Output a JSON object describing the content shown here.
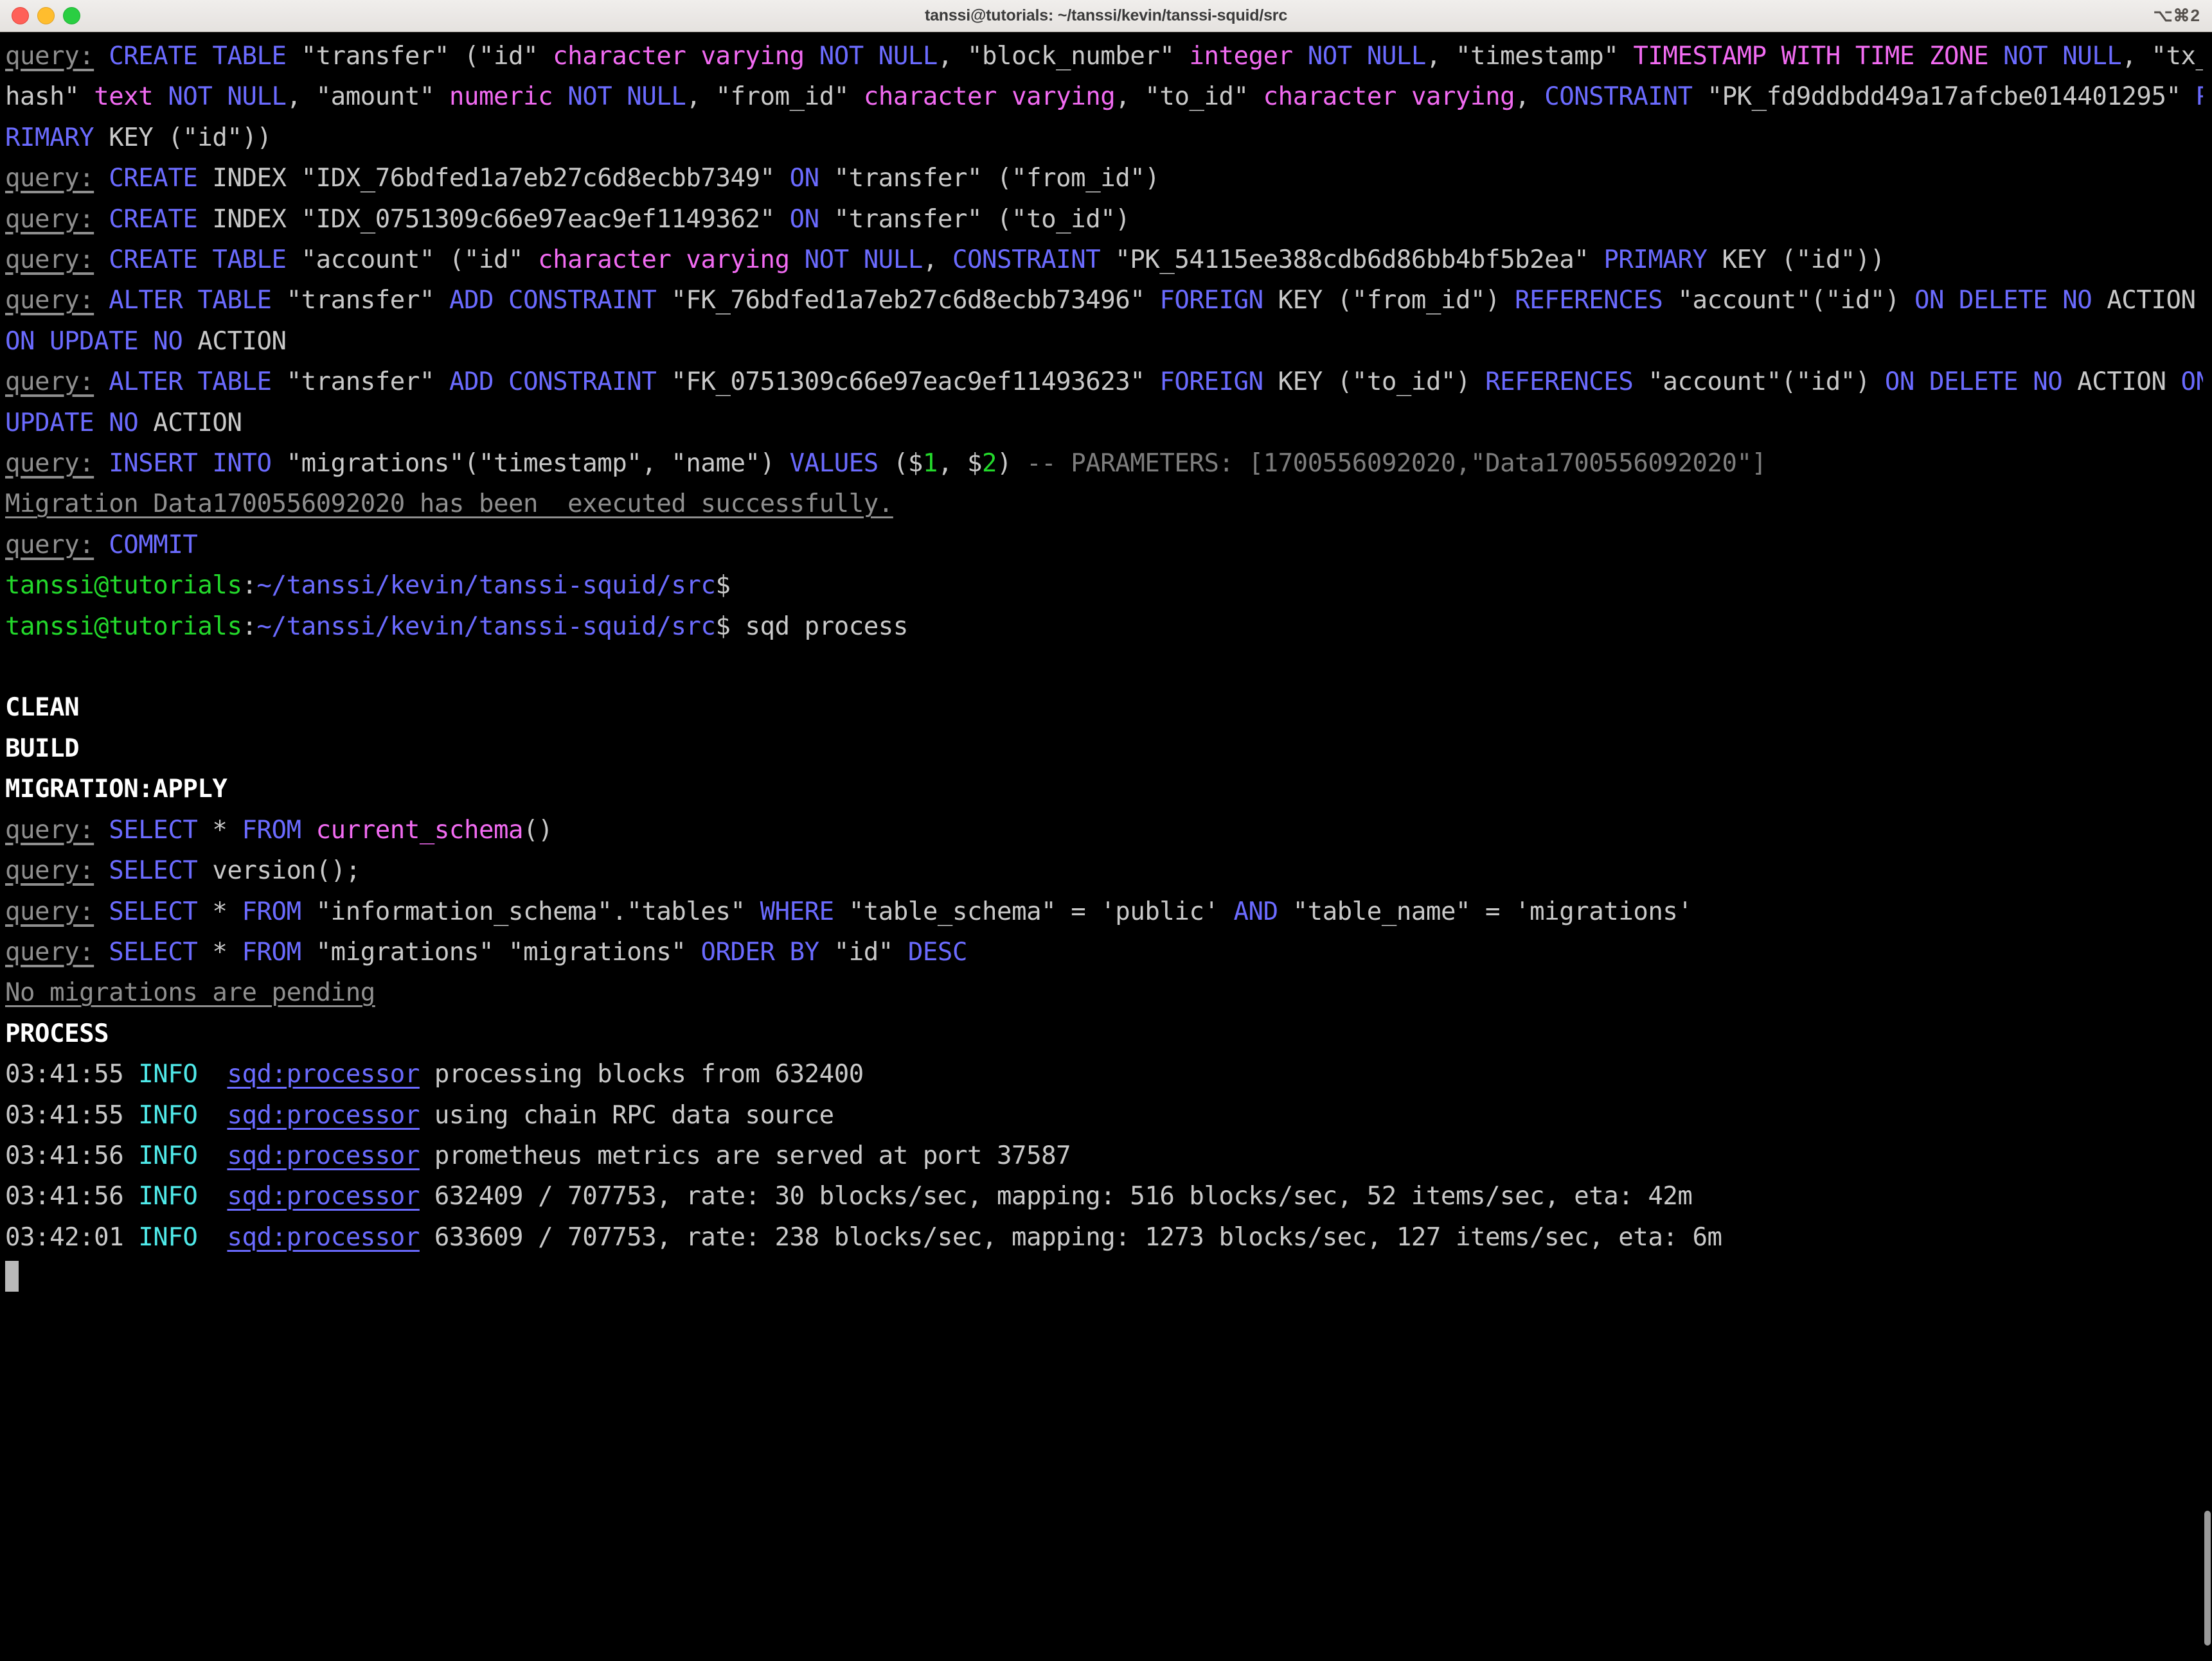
{
  "window": {
    "title": "tanssi@tutorials: ~/tanssi/kevin/tanssi-squid/src",
    "shortcut_badge": "⌥⌘2",
    "traffic_lights": [
      "close",
      "minimize",
      "maximize"
    ],
    "colors": {
      "titlebar_bg": "#ebe8e5",
      "terminal_bg": "#000000",
      "foreground": "#c9c9c9",
      "blue": "#6b6bff",
      "magenta": "#f26bf2",
      "green": "#23d92b",
      "cyan": "#4fe9e9",
      "gray": "#8f8f8f"
    }
  },
  "terminal": {
    "lines": [
      {
        "id": "l1",
        "segments": [
          {
            "text": "query:",
            "style": "qtag"
          },
          {
            "text": " ",
            "style": "white"
          },
          {
            "text": "CREATE TABLE",
            "style": "blue"
          },
          {
            "text": " \"transfer\" (\"id\" ",
            "style": "white"
          },
          {
            "text": "character varying",
            "style": "magenta"
          },
          {
            "text": " ",
            "style": "white"
          },
          {
            "text": "NOT NULL",
            "style": "blue"
          },
          {
            "text": ", \"block_number\" ",
            "style": "white"
          },
          {
            "text": "integer",
            "style": "magenta"
          },
          {
            "text": " ",
            "style": "white"
          },
          {
            "text": "NOT NULL",
            "style": "blue"
          },
          {
            "text": ", \"timestamp\" ",
            "style": "white"
          },
          {
            "text": "TIMESTAMP WITH TIME ZONE",
            "style": "magenta"
          },
          {
            "text": " ",
            "style": "white"
          },
          {
            "text": "NOT NULL",
            "style": "blue"
          },
          {
            "text": ", \"tx_hash\" ",
            "style": "white"
          },
          {
            "text": "text",
            "style": "magenta"
          },
          {
            "text": " ",
            "style": "white"
          },
          {
            "text": "NOT NULL",
            "style": "blue"
          },
          {
            "text": ", \"amount\" ",
            "style": "white"
          },
          {
            "text": "numeric",
            "style": "magenta"
          },
          {
            "text": " ",
            "style": "white"
          },
          {
            "text": "NOT NULL",
            "style": "blue"
          },
          {
            "text": ", \"from_id\" ",
            "style": "white"
          },
          {
            "text": "character varying",
            "style": "magenta"
          },
          {
            "text": ", \"to_id\" ",
            "style": "white"
          },
          {
            "text": "character varying",
            "style": "magenta"
          },
          {
            "text": ", ",
            "style": "white"
          },
          {
            "text": "CONSTRAINT",
            "style": "blue"
          },
          {
            "text": " \"PK_fd9ddbdd49a17afcbe014401295\" ",
            "style": "white"
          },
          {
            "text": "PRIMARY",
            "style": "blue"
          },
          {
            "text": " KEY (\"id\"))",
            "style": "white"
          }
        ]
      },
      {
        "id": "l2",
        "segments": [
          {
            "text": "query:",
            "style": "qtag"
          },
          {
            "text": " ",
            "style": "white"
          },
          {
            "text": "CREATE",
            "style": "blue"
          },
          {
            "text": " INDEX \"IDX_76bdfed1a7eb27c6d8ecbb7349\" ",
            "style": "white"
          },
          {
            "text": "ON",
            "style": "blue"
          },
          {
            "text": " \"transfer\" (\"from_id\")",
            "style": "white"
          }
        ]
      },
      {
        "id": "l3",
        "segments": [
          {
            "text": "query:",
            "style": "qtag"
          },
          {
            "text": " ",
            "style": "white"
          },
          {
            "text": "CREATE",
            "style": "blue"
          },
          {
            "text": " INDEX \"IDX_0751309c66e97eac9ef1149362\" ",
            "style": "white"
          },
          {
            "text": "ON",
            "style": "blue"
          },
          {
            "text": " \"transfer\" (\"to_id\")",
            "style": "white"
          }
        ]
      },
      {
        "id": "l4",
        "segments": [
          {
            "text": "query:",
            "style": "qtag"
          },
          {
            "text": " ",
            "style": "white"
          },
          {
            "text": "CREATE TABLE",
            "style": "blue"
          },
          {
            "text": " \"account\" (\"id\" ",
            "style": "white"
          },
          {
            "text": "character varying",
            "style": "magenta"
          },
          {
            "text": " ",
            "style": "white"
          },
          {
            "text": "NOT NULL",
            "style": "blue"
          },
          {
            "text": ", ",
            "style": "white"
          },
          {
            "text": "CONSTRAINT",
            "style": "blue"
          },
          {
            "text": " \"PK_54115ee388cdb6d86bb4bf5b2ea\" ",
            "style": "white"
          },
          {
            "text": "PRIMARY",
            "style": "blue"
          },
          {
            "text": " KEY (\"id\"))",
            "style": "white"
          }
        ]
      },
      {
        "id": "l5",
        "segments": [
          {
            "text": "query:",
            "style": "qtag"
          },
          {
            "text": " ",
            "style": "white"
          },
          {
            "text": "ALTER TABLE",
            "style": "blue"
          },
          {
            "text": " \"transfer\" ",
            "style": "white"
          },
          {
            "text": "ADD CONSTRAINT",
            "style": "blue"
          },
          {
            "text": " \"FK_76bdfed1a7eb27c6d8ecbb73496\" ",
            "style": "white"
          },
          {
            "text": "FOREIGN",
            "style": "blue"
          },
          {
            "text": " KEY (\"from_id\") ",
            "style": "white"
          },
          {
            "text": "REFERENCES",
            "style": "blue"
          },
          {
            "text": " \"account\"(\"id\") ",
            "style": "white"
          },
          {
            "text": "ON DELETE NO",
            "style": "blue"
          },
          {
            "text": " ACTION ",
            "style": "white"
          },
          {
            "text": "ON UPDATE NO",
            "style": "blue"
          },
          {
            "text": " ACTION",
            "style": "white"
          }
        ]
      },
      {
        "id": "l6",
        "segments": [
          {
            "text": "query:",
            "style": "qtag"
          },
          {
            "text": " ",
            "style": "white"
          },
          {
            "text": "ALTER TABLE",
            "style": "blue"
          },
          {
            "text": " \"transfer\" ",
            "style": "white"
          },
          {
            "text": "ADD CONSTRAINT",
            "style": "blue"
          },
          {
            "text": " \"FK_0751309c66e97eac9ef11493623\" ",
            "style": "white"
          },
          {
            "text": "FOREIGN",
            "style": "blue"
          },
          {
            "text": " KEY (\"to_id\") ",
            "style": "white"
          },
          {
            "text": "REFERENCES",
            "style": "blue"
          },
          {
            "text": " \"account\"(\"id\") ",
            "style": "white"
          },
          {
            "text": "ON DELETE NO",
            "style": "blue"
          },
          {
            "text": " ACTION ",
            "style": "white"
          },
          {
            "text": "ON UPDATE NO",
            "style": "blue"
          },
          {
            "text": " ACTION",
            "style": "white"
          }
        ]
      },
      {
        "id": "l7",
        "segments": [
          {
            "text": "query:",
            "style": "qtag"
          },
          {
            "text": " ",
            "style": "white"
          },
          {
            "text": "INSERT INTO",
            "style": "blue"
          },
          {
            "text": " \"migrations\"(\"timestamp\", \"name\") ",
            "style": "white"
          },
          {
            "text": "VALUES",
            "style": "blue"
          },
          {
            "text": " ($",
            "style": "white"
          },
          {
            "text": "1",
            "style": "green"
          },
          {
            "text": ", $",
            "style": "white"
          },
          {
            "text": "2",
            "style": "green"
          },
          {
            "text": ") ",
            "style": "white"
          },
          {
            "text": "-- PARAMETERS: [1700556092020,\"Data1700556092020\"]",
            "style": "dim"
          }
        ]
      },
      {
        "id": "l8",
        "segments": [
          {
            "text": "Migration Data1700556092020 has been  executed successfully.",
            "style": "gray-underline"
          }
        ]
      },
      {
        "id": "l9",
        "segments": [
          {
            "text": "query:",
            "style": "qtag"
          },
          {
            "text": " ",
            "style": "white"
          },
          {
            "text": "COMMIT",
            "style": "blue"
          }
        ]
      },
      {
        "id": "l10",
        "segments": [
          {
            "text": "tanssi@tutorials",
            "style": "promptuser"
          },
          {
            "text": ":",
            "style": "white"
          },
          {
            "text": "~/tanssi/kevin/tanssi-squid/src",
            "style": "promptpath"
          },
          {
            "text": "$",
            "style": "white"
          }
        ]
      },
      {
        "id": "l11",
        "segments": [
          {
            "text": "tanssi@tutorials",
            "style": "promptuser"
          },
          {
            "text": ":",
            "style": "white"
          },
          {
            "text": "~/tanssi/kevin/tanssi-squid/src",
            "style": "promptpath"
          },
          {
            "text": "$ sqd process",
            "style": "white"
          }
        ]
      },
      {
        "id": "l12",
        "segments": [
          {
            "text": "",
            "style": "white"
          }
        ]
      },
      {
        "id": "l13",
        "segments": [
          {
            "text": "CLEAN",
            "style": "bold"
          }
        ]
      },
      {
        "id": "l14",
        "segments": [
          {
            "text": "BUILD",
            "style": "bold"
          }
        ]
      },
      {
        "id": "l15",
        "segments": [
          {
            "text": "MIGRATION:APPLY",
            "style": "bold"
          }
        ]
      },
      {
        "id": "l16",
        "segments": [
          {
            "text": "query:",
            "style": "qtag"
          },
          {
            "text": " ",
            "style": "white"
          },
          {
            "text": "SELECT",
            "style": "blue"
          },
          {
            "text": " * ",
            "style": "white"
          },
          {
            "text": "FROM",
            "style": "blue"
          },
          {
            "text": " ",
            "style": "white"
          },
          {
            "text": "current_schema",
            "style": "magenta"
          },
          {
            "text": "()",
            "style": "white"
          }
        ]
      },
      {
        "id": "l17",
        "segments": [
          {
            "text": "query:",
            "style": "qtag"
          },
          {
            "text": " ",
            "style": "white"
          },
          {
            "text": "SELECT",
            "style": "blue"
          },
          {
            "text": " version();",
            "style": "white"
          }
        ]
      },
      {
        "id": "l18",
        "segments": [
          {
            "text": "query:",
            "style": "qtag"
          },
          {
            "text": " ",
            "style": "white"
          },
          {
            "text": "SELECT",
            "style": "blue"
          },
          {
            "text": " * ",
            "style": "white"
          },
          {
            "text": "FROM",
            "style": "blue"
          },
          {
            "text": " \"information_schema\".\"tables\" ",
            "style": "white"
          },
          {
            "text": "WHERE",
            "style": "blue"
          },
          {
            "text": " \"table_schema\" = 'public' ",
            "style": "white"
          },
          {
            "text": "AND",
            "style": "blue"
          },
          {
            "text": " \"table_name\" = 'migrations'",
            "style": "white"
          }
        ]
      },
      {
        "id": "l19",
        "segments": [
          {
            "text": "query:",
            "style": "qtag"
          },
          {
            "text": " ",
            "style": "white"
          },
          {
            "text": "SELECT",
            "style": "blue"
          },
          {
            "text": " * ",
            "style": "white"
          },
          {
            "text": "FROM",
            "style": "blue"
          },
          {
            "text": " \"migrations\" \"migrations\" ",
            "style": "white"
          },
          {
            "text": "ORDER BY",
            "style": "blue"
          },
          {
            "text": " \"id\" ",
            "style": "white"
          },
          {
            "text": "DESC",
            "style": "blue"
          }
        ]
      },
      {
        "id": "l20",
        "segments": [
          {
            "text": "No migrations are pending",
            "style": "gray-underline"
          }
        ]
      },
      {
        "id": "l21",
        "segments": [
          {
            "text": "PROCESS",
            "style": "bold"
          }
        ]
      },
      {
        "id": "l22",
        "segments": [
          {
            "text": "03:41:55",
            "style": "white"
          },
          {
            "text": " ",
            "style": "white"
          },
          {
            "text": "INFO",
            "style": "cyan"
          },
          {
            "text": "  ",
            "style": "white"
          },
          {
            "text": "sqd:processor",
            "style": "logname"
          },
          {
            "text": " processing blocks from 632400",
            "style": "white"
          }
        ]
      },
      {
        "id": "l23",
        "segments": [
          {
            "text": "03:41:55",
            "style": "white"
          },
          {
            "text": " ",
            "style": "white"
          },
          {
            "text": "INFO",
            "style": "cyan"
          },
          {
            "text": "  ",
            "style": "white"
          },
          {
            "text": "sqd:processor",
            "style": "logname"
          },
          {
            "text": " using chain RPC data source",
            "style": "white"
          }
        ]
      },
      {
        "id": "l24",
        "segments": [
          {
            "text": "03:41:56",
            "style": "white"
          },
          {
            "text": " ",
            "style": "white"
          },
          {
            "text": "INFO",
            "style": "cyan"
          },
          {
            "text": "  ",
            "style": "white"
          },
          {
            "text": "sqd:processor",
            "style": "logname"
          },
          {
            "text": " prometheus metrics are served at port 37587",
            "style": "white"
          }
        ]
      },
      {
        "id": "l25",
        "segments": [
          {
            "text": "03:41:56",
            "style": "white"
          },
          {
            "text": " ",
            "style": "white"
          },
          {
            "text": "INFO",
            "style": "cyan"
          },
          {
            "text": "  ",
            "style": "white"
          },
          {
            "text": "sqd:processor",
            "style": "logname"
          },
          {
            "text": " 632409 / 707753, rate: 30 blocks/sec, mapping: 516 blocks/sec, 52 items/sec, eta: 42m",
            "style": "white"
          }
        ]
      },
      {
        "id": "l26",
        "segments": [
          {
            "text": "03:42:01",
            "style": "white"
          },
          {
            "text": " ",
            "style": "white"
          },
          {
            "text": "INFO",
            "style": "cyan"
          },
          {
            "text": "  ",
            "style": "white"
          },
          {
            "text": "sqd:processor",
            "style": "logname"
          },
          {
            "text": " 633609 / 707753, rate: 238 blocks/sec, mapping: 1273 blocks/sec, 127 items/sec, eta: 6m",
            "style": "white"
          }
        ]
      }
    ],
    "cursor": {
      "visible": true,
      "shape": "block"
    }
  },
  "process_stats": {
    "blocks_start": 632400,
    "total_blocks": 707753,
    "samples": [
      {
        "time": "03:41:56",
        "current": 632409,
        "rate_blocks_per_sec": 30,
        "mapping_blocks_per_sec": 516,
        "items_per_sec": 52,
        "eta": "42m"
      },
      {
        "time": "03:42:01",
        "current": 633609,
        "rate_blocks_per_sec": 238,
        "mapping_blocks_per_sec": 1273,
        "items_per_sec": 127,
        "eta": "6m"
      }
    ],
    "prometheus_port": 37587,
    "data_source": "chain RPC"
  }
}
